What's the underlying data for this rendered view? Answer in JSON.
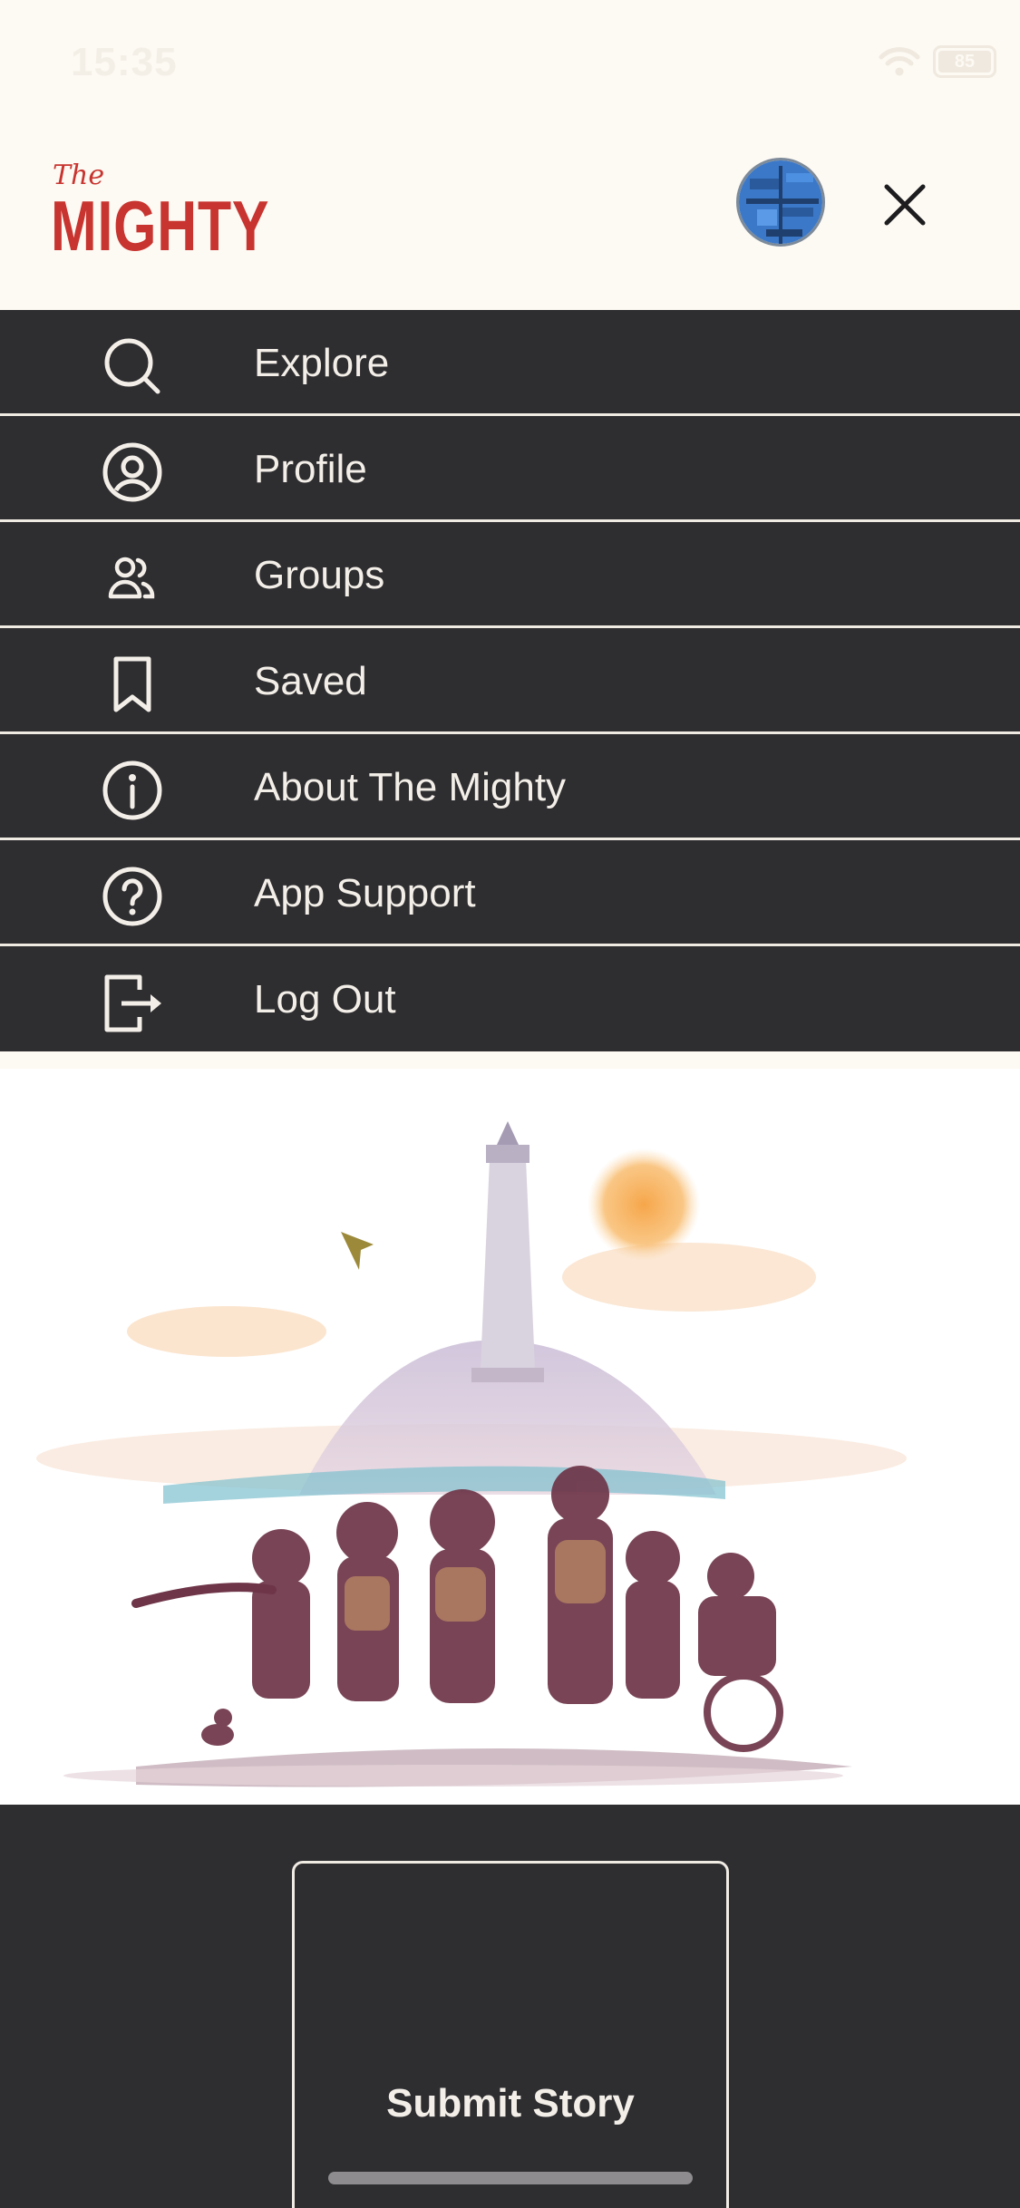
{
  "status_bar": {
    "time": "15:35",
    "battery": "85"
  },
  "header": {
    "logo_the": "The",
    "logo_main": "MIGHTY",
    "avatar_icon": "user-avatar",
    "close_icon": "close-icon"
  },
  "menu": {
    "items": [
      {
        "label": "Explore",
        "icon": "search-icon"
      },
      {
        "label": "Profile",
        "icon": "profile-icon"
      },
      {
        "label": "Groups",
        "icon": "groups-icon"
      },
      {
        "label": "Saved",
        "icon": "bookmark-icon"
      },
      {
        "label": "About The Mighty",
        "icon": "info-icon"
      },
      {
        "label": "App Support",
        "icon": "help-icon"
      },
      {
        "label": "Log Out",
        "icon": "logout-icon"
      }
    ]
  },
  "illustration": {
    "icon": "community-lighthouse-illustration"
  },
  "bottom": {
    "submit_label": "Submit Story"
  },
  "colors": {
    "brand_red": "#c8342f",
    "menu_bg": "#2e2d30",
    "menu_text": "#f3efe8",
    "header_bg": "#fdf9f3"
  }
}
